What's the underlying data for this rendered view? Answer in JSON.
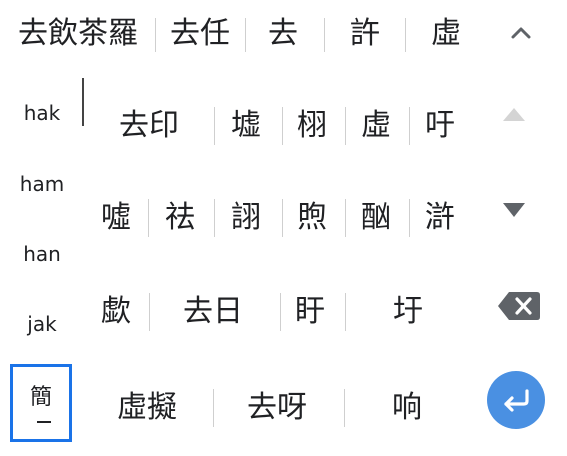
{
  "suggestions": [
    "去飲茶羅",
    "去任",
    "去",
    "許",
    "虛"
  ],
  "pinyin": [
    "hak",
    "ham",
    "han",
    "jak"
  ],
  "rows": [
    [
      "去印",
      "墟",
      "栩",
      "虛",
      "吁"
    ],
    [
      "噓",
      "祛",
      "詡",
      "煦",
      "酗",
      "滸"
    ],
    [
      "歔",
      "去日",
      "盱",
      "圩"
    ],
    [
      "虛擬",
      "去呀",
      "响"
    ]
  ],
  "mode_toggle": {
    "label": "簡"
  },
  "icons": {
    "collapse": "chevron-up-icon",
    "page_up": "triangle-up-icon",
    "page_down": "triangle-down-icon",
    "backspace": "backspace-icon",
    "enter": "enter-icon"
  },
  "colors": {
    "accent": "#1a73e8",
    "enter_bg": "#4a90e2",
    "disabled": "#d4d4d4"
  }
}
